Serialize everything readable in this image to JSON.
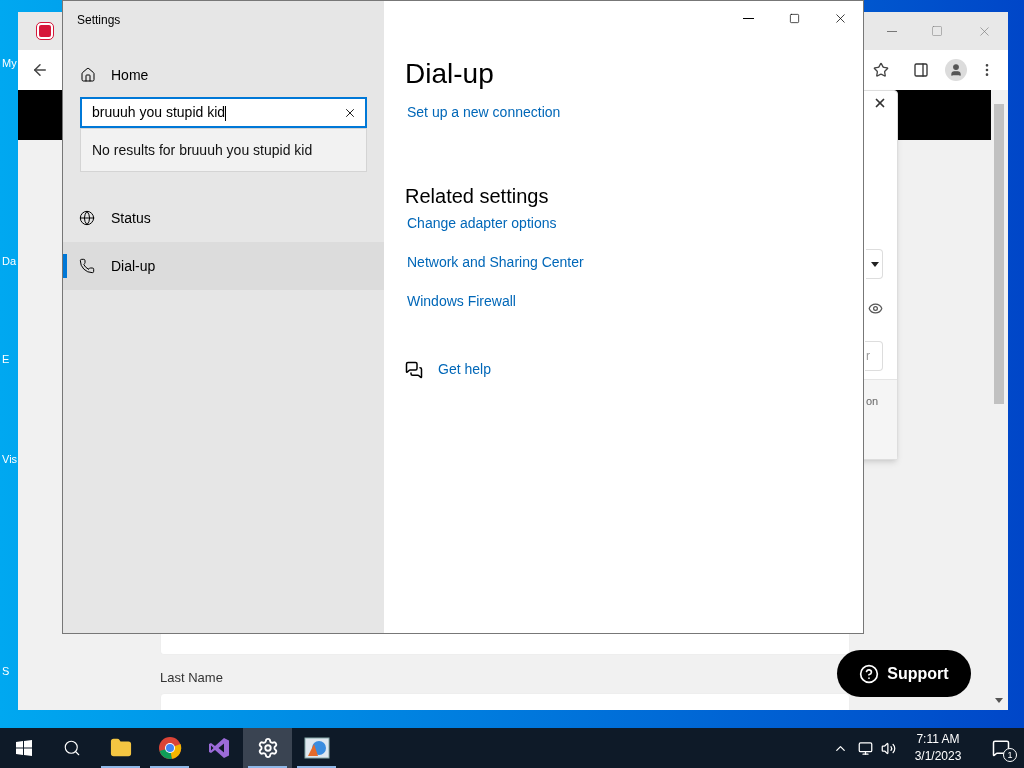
{
  "desktop": {
    "icons": [
      {
        "label": "My"
      },
      {
        "label": "Da"
      },
      {
        "label": "E"
      },
      {
        "label": "Vis"
      },
      {
        "label": "S"
      }
    ]
  },
  "browser": {
    "dialog_field_fragment": "r",
    "dialog_text_fragment": "on",
    "form_label": "Last Name",
    "support_button": "Support"
  },
  "settings": {
    "title": "Settings",
    "home": "Home",
    "search": {
      "value": "bruuuh you stupid kid"
    },
    "search_result": "No results for bruuuh you stupid kid",
    "nav": [
      {
        "label": "Status",
        "kind": "status",
        "selected": false
      },
      {
        "label": "Dial-up",
        "kind": "dialup",
        "selected": true
      }
    ],
    "page_title": "Dial-up",
    "primary_link": "Set up a new connection",
    "related_heading": "Related settings",
    "related_links": [
      "Change adapter options",
      "Network and Sharing Center",
      "Windows Firewall"
    ],
    "help_link": "Get help"
  },
  "taskbar": {
    "apps": [
      {
        "kind": "explorer",
        "selected": false,
        "running": true
      },
      {
        "kind": "chrome",
        "selected": false,
        "running": true
      },
      {
        "kind": "studio",
        "selected": false,
        "running": false
      },
      {
        "kind": "settings",
        "selected": true,
        "running": true
      },
      {
        "kind": "network",
        "selected": false,
        "running": true
      }
    ],
    "time": "7:11 AM",
    "date": "3/1/2023",
    "notification_count": "1"
  }
}
